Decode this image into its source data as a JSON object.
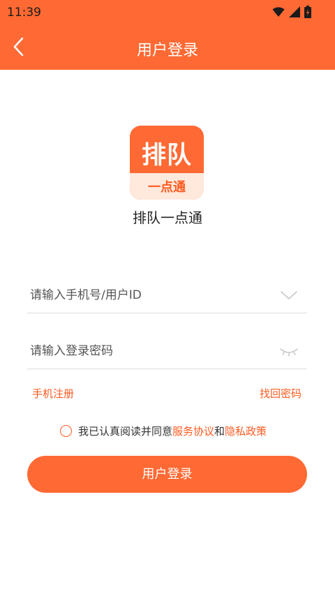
{
  "status_bar": {
    "time": "11:39",
    "icons": [
      "wifi-icon",
      "cellular-signal-icon",
      "battery-charging-icon"
    ]
  },
  "header": {
    "title": "用户登录",
    "back_icon": "chevron-left-icon"
  },
  "logo": {
    "main_text": "排队",
    "sub_text": "一点通"
  },
  "app_name": "排队一点通",
  "form": {
    "username_placeholder": "请输入手机号/用户ID",
    "username_value": "",
    "username_icon": "chevron-down-icon",
    "password_placeholder": "请输入登录密码",
    "password_value": "",
    "password_icon": "eye-closed-icon"
  },
  "links": {
    "register": "手机注册",
    "forgot_password": "找回密码"
  },
  "agreement": {
    "prefix": "我已认真阅读并同意",
    "service_terms": "服务协议",
    "conjunction": "和",
    "privacy_policy": "隐私政策",
    "checked": false
  },
  "login_button": "用户登录",
  "colors": {
    "accent": "#ff6933",
    "link": "#ff5a1f",
    "logo_sub_bg": "#ffe9dc"
  }
}
